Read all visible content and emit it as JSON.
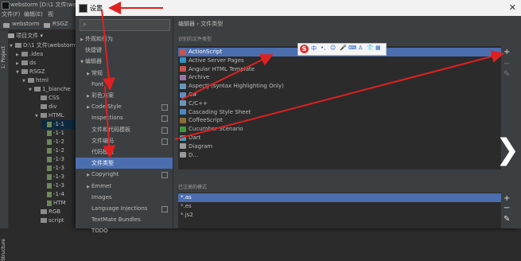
{
  "ide": {
    "title": "webstorm [D:\\1 文件\\websto",
    "menu": [
      "文件(F)",
      "编辑(E)",
      "视"
    ],
    "crumbs": [
      "webstorm",
      "RSGZ"
    ],
    "strip_label": "1: Project",
    "strip_label_bottom": "Structure",
    "project_header": "项目文件 ▾",
    "tree": [
      {
        "indent": 0,
        "arrow": "▼",
        "icon": "folder",
        "label": "D:\\1 文件\\webstorm"
      },
      {
        "indent": 1,
        "arrow": "▶",
        "icon": "folder",
        "label": ".idea"
      },
      {
        "indent": 1,
        "arrow": "▶",
        "icon": "folder",
        "label": "ds"
      },
      {
        "indent": 1,
        "arrow": "▼",
        "icon": "folder",
        "label": "RSGZ"
      },
      {
        "indent": 2,
        "arrow": "▼",
        "icon": "folder",
        "label": "html"
      },
      {
        "indent": 3,
        "arrow": "▼",
        "icon": "folder",
        "label": "1_bianche"
      },
      {
        "indent": 4,
        "arrow": "",
        "icon": "folder",
        "label": "CSS"
      },
      {
        "indent": 4,
        "arrow": "",
        "icon": "folder",
        "label": "div"
      },
      {
        "indent": 4,
        "arrow": "▼",
        "icon": "folder",
        "label": "HTML"
      },
      {
        "indent": 5,
        "arrow": "",
        "icon": "file",
        "label": "-1-1",
        "selected": true
      },
      {
        "indent": 5,
        "arrow": "",
        "icon": "file",
        "label": "-1-1"
      },
      {
        "indent": 5,
        "arrow": "",
        "icon": "file",
        "label": "-1-2"
      },
      {
        "indent": 5,
        "arrow": "",
        "icon": "file",
        "label": "-1-2"
      },
      {
        "indent": 5,
        "arrow": "",
        "icon": "file",
        "label": "-1-3"
      },
      {
        "indent": 5,
        "arrow": "",
        "icon": "file",
        "label": "-1-3"
      },
      {
        "indent": 5,
        "arrow": "",
        "icon": "file",
        "label": "-1-3"
      },
      {
        "indent": 5,
        "arrow": "",
        "icon": "file",
        "label": "-1-3"
      },
      {
        "indent": 5,
        "arrow": "",
        "icon": "file",
        "label": "-1-4"
      },
      {
        "indent": 5,
        "arrow": "",
        "icon": "file",
        "label": "HTM"
      },
      {
        "indent": 4,
        "arrow": "",
        "icon": "folder",
        "label": "RGB"
      },
      {
        "indent": 4,
        "arrow": "",
        "icon": "folder",
        "label": "script"
      }
    ]
  },
  "dialog": {
    "title": "设置",
    "close": "✕",
    "search_placeholder": "",
    "nav": [
      {
        "arrow": "▶",
        "label": "外观和行为",
        "copy": false
      },
      {
        "arrow": "",
        "label": "快捷键",
        "copy": false
      },
      {
        "arrow": "▼",
        "label": "编辑器",
        "copy": false
      },
      {
        "arrow": "▶",
        "label": "常规",
        "copy": false,
        "indent": true
      },
      {
        "arrow": "",
        "label": "Font",
        "copy": false,
        "indent": true
      },
      {
        "arrow": "▶",
        "label": "彩色方案",
        "copy": false,
        "indent": true
      },
      {
        "arrow": "▶",
        "label": "Code Style",
        "copy": true,
        "indent": true
      },
      {
        "arrow": "",
        "label": "Inspections",
        "copy": true,
        "indent": true
      },
      {
        "arrow": "",
        "label": "文件和代码模板",
        "copy": true,
        "indent": true
      },
      {
        "arrow": "",
        "label": "文件编码",
        "copy": true,
        "indent": true
      },
      {
        "arrow": "",
        "label": "代码模板",
        "copy": false,
        "indent": true
      },
      {
        "arrow": "",
        "label": "文件类型",
        "copy": false,
        "indent": true,
        "selected": true
      },
      {
        "arrow": "▶",
        "label": "Copyright",
        "copy": true,
        "indent": true
      },
      {
        "arrow": "▶",
        "label": "Emmet",
        "copy": false,
        "indent": true
      },
      {
        "arrow": "",
        "label": "Images",
        "copy": false,
        "indent": true
      },
      {
        "arrow": "",
        "label": "Language Injections",
        "copy": true,
        "indent": true
      },
      {
        "arrow": "",
        "label": "TextMate Bundles",
        "copy": false,
        "indent": true
      },
      {
        "arrow": "",
        "label": "TODO",
        "copy": false,
        "indent": true
      }
    ],
    "breadcrumb": "编辑器  ›  文件类型",
    "recognized_label": "识别的文件类型",
    "file_types": [
      {
        "label": "ActionScript",
        "color": "#c75450",
        "selected": true
      },
      {
        "label": "Active Server Pages",
        "color": "#3592c4"
      },
      {
        "label": "Angular HTML Template",
        "color": "#c75450"
      },
      {
        "label": "Archive",
        "color": "#9876aa"
      },
      {
        "label": "AspectJ (syntax Highlighting Only)",
        "color": "#6897bb"
      },
      {
        "label": "C#",
        "color": "#5f8fbf"
      },
      {
        "label": "C/C++",
        "color": "#6897bb"
      },
      {
        "label": "Cascading Style Sheet",
        "color": "#4a88c7"
      },
      {
        "label": "CoffeeScript",
        "color": "#8c6b3c"
      },
      {
        "label": "Cucumber Scenario",
        "color": "#3c9a3c"
      },
      {
        "label": "Dart",
        "color": "#40a0c0"
      },
      {
        "label": "Diagram",
        "color": "#9a9a9a"
      },
      {
        "label": "D...",
        "color": "#9a9a9a"
      }
    ],
    "ime": {
      "s": "S",
      "items": [
        "中",
        "•,",
        "☺",
        "🎤",
        "⌨",
        "♙",
        "👕",
        "▦"
      ]
    },
    "registered_label": "已注册的模式",
    "patterns": [
      {
        "label": "*.as",
        "selected": true
      },
      {
        "label": "*.es"
      },
      {
        "label": "*.js2"
      }
    ],
    "btn_add": "+",
    "btn_remove": "−",
    "btn_edit": "✎"
  },
  "overlay": {
    "chevron": "❯",
    "arrow_color": "#e02020"
  }
}
